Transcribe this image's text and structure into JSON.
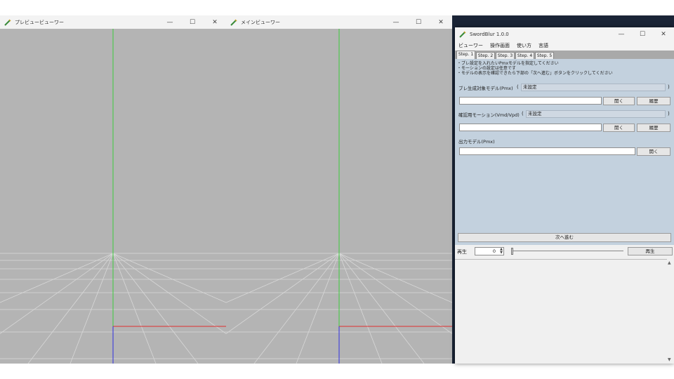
{
  "preview_window": {
    "title": "プレビュービューワー"
  },
  "main_window": {
    "title": "メインビューワー"
  },
  "window_controls": {
    "minimize": "—",
    "maximize": "☐",
    "close": "✕"
  },
  "swordblur": {
    "title": "SwordBlur 1.0.0",
    "menu": [
      "ビューワー",
      "操作画面",
      "使い方",
      "言語"
    ],
    "tabs": [
      "Step. 1",
      "Step. 2",
      "Step. 3",
      "Step. 4",
      "Step. 5"
    ],
    "instructions": [
      "・ブレ設定を入れたいPmxモデルを指定してください",
      "・モーションの設定は任意です",
      "・モデルの表示を確認できたら下部の「次へ進む」ボタンをクリックしてください"
    ],
    "model_label": "ブレ生成対象モデル(Pmx)",
    "model_status": "未設定",
    "motion_label": "確認用モーション(Vmd/Vpd)",
    "motion_status": "未設定",
    "output_label": "出力モデル(Pmx)",
    "open_label": "開く",
    "history_label": "履歴",
    "paren_open": "(",
    "paren_close": ")",
    "next_label": "次へ進む",
    "play_label": "再生",
    "frame_value": "0",
    "play_button": "再生"
  },
  "colors": {
    "viewport_bg": "#b4b4b4",
    "panel_bg": "#c3d1de",
    "axis_y": "#3ccc3c",
    "axis_x": "#e03030",
    "axis_z": "#3030e0"
  }
}
